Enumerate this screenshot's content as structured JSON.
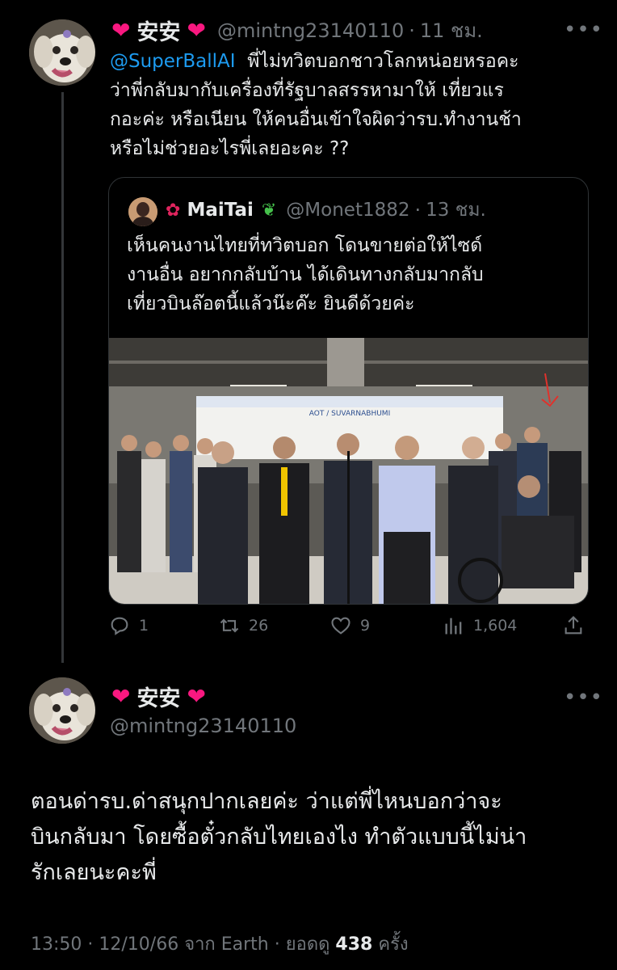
{
  "reply": {
    "display_name": "安安",
    "handle": "@mintng23140110",
    "time": "11 ชม.",
    "mention": "@SuperBallAI",
    "text_line1": "พี่ไม่ทวิตบอกชาวโลกหน่อยหรอคะ",
    "text_line2": "ว่าพี่กลับมากับเครื่องที่รัฐบาลสรรหามาให้ เที่ยวแร",
    "text_line3": "กอะค่ะ หรือเนียน ให้คนอื่นเข้าใจผิดว่ารบ.ทำงานช้า",
    "text_line4": "หรือไม่ช่วยอะไรพี่เลยอะคะ ??"
  },
  "quote": {
    "display_name": "MaiTai",
    "handle": "@Monet1882",
    "time": "13 ชม.",
    "text_line1": "เห็นคนงานไทยที่ทวิตบอก โดนขายต่อให้ไซด์",
    "text_line2": "งานอื่น อยากกลับบ้าน ได้เดินทางกลับมากลับ",
    "text_line3": "เที่ยวบินล๊อตนี้แล้วน๊ะค๊ะ ยินดีด้วยค่ะ",
    "photo_sign": "AOT / SUVARNABHUMI"
  },
  "actions": {
    "replies": "1",
    "retweets": "26",
    "likes": "9",
    "views": "1,604"
  },
  "main": {
    "display_name": "安安",
    "handle": "@mintng23140110",
    "text_line1": "ตอนด่ารบ.ด่าสนุกปากเลยค่ะ ว่าแต่พี่ไหนบอกว่าจะ",
    "text_line2": "บินกลับมา โดยซื้อตั๋วกลับไทยเองไง ทำตัวแบบนี้ไม่น่า",
    "text_line3": "รักเลยนะคะพี่"
  },
  "meta": {
    "time_date": "13:50 · 12/10/66",
    "via": "จาก Earth ·",
    "views_label": "ยอดดู",
    "views_count": "438",
    "views_unit": "ครั้ง"
  },
  "colors": {
    "background": "#000000",
    "text": "#e7e9ea",
    "muted": "#71767b",
    "link": "#1d9bf0",
    "heart": "#f91880",
    "border": "#2f3336"
  },
  "icons": {
    "heart": "red-heart-emoji",
    "hibiscus": "hibiscus-emoji",
    "herb": "herb-emoji"
  }
}
